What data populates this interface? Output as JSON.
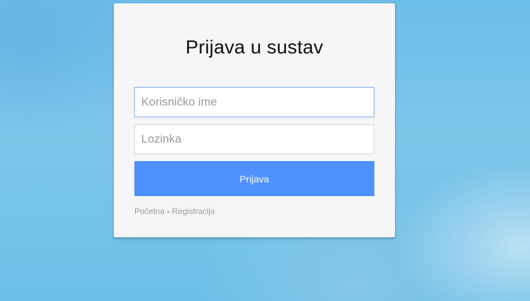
{
  "login": {
    "title": "Prijava u sustav",
    "username_placeholder": "Korisničko ime",
    "password_placeholder": "Lozinka",
    "submit_label": "Prijava"
  },
  "footer": {
    "home_link": "Početna",
    "separator": "-",
    "register_link": "Registracija"
  },
  "colors": {
    "button": "#4d90fe",
    "card": "#f6f6f6",
    "focus_border": "#8fb4ef"
  }
}
